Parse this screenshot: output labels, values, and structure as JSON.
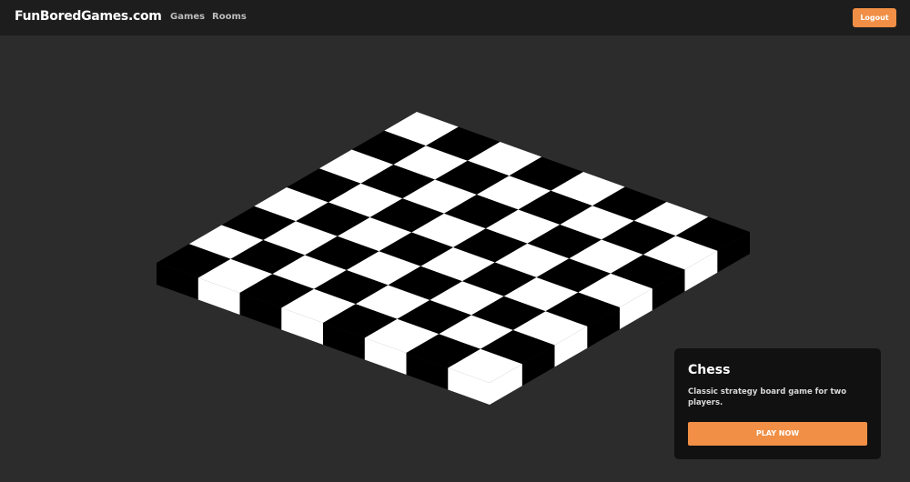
{
  "navbar": {
    "logo": "FunBoredGames.com",
    "links": [
      "Games",
      "Rooms"
    ],
    "logout_label": "Logout",
    "accent_color": "#f08f45",
    "background_color": "#1d1d1d"
  },
  "board": {
    "rows": 8,
    "cols": 8,
    "light_color": "#ffffff",
    "dark_color": "#000000"
  },
  "game_card": {
    "title": "Chess",
    "description": "Classic strategy board game for two players.",
    "play_label": "PLAY NOW"
  }
}
